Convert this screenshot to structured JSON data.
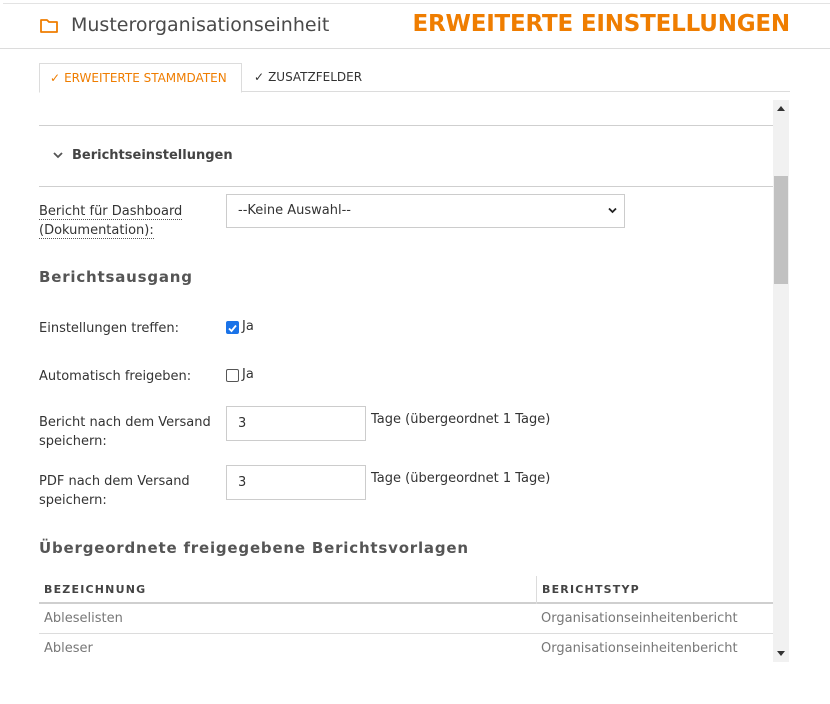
{
  "header": {
    "org_name": "Musterorganisationseinheit",
    "page_title": "ERWEITERTE EINSTELLUNGEN",
    "folder_icon": "folder-icon",
    "accent_color": "#ef7d00"
  },
  "tabs": [
    {
      "label": "ERWEITERTE STAMMDATEN",
      "check": "✓",
      "active": true
    },
    {
      "label": "ZUSATZFELDER",
      "check": "✓",
      "active": false
    }
  ],
  "report_settings": {
    "section_label": "Berichtseinstellungen",
    "dashboard_label_line1": "Bericht für Dashboard",
    "dashboard_label_line2": "(Dokumentation):",
    "dashboard_value": "--Keine Auswahl--"
  },
  "report_output": {
    "heading": "Berichtsausgang",
    "settings_label": "Einstellungen treffen:",
    "settings_checked": true,
    "settings_text": "Ja",
    "auto_label": "Automatisch freigeben:",
    "auto_checked": false,
    "auto_text": "Ja",
    "report_keep_label_line1": "Bericht nach dem Versand",
    "report_keep_label_line2": "speichern:",
    "report_keep_value": "3",
    "report_keep_hint": "Tage (übergeordnet 1 Tage)",
    "pdf_keep_label_line1": "PDF nach dem Versand",
    "pdf_keep_label_line2": "speichern:",
    "pdf_keep_value": "3",
    "pdf_keep_hint": "Tage (übergeordnet 1 Tage)"
  },
  "templates": {
    "heading": "Übergeordnete freigegebene Berichtsvorlagen",
    "columns": [
      "BEZEICHNUNG",
      "BERICHTSTYP"
    ],
    "rows": [
      {
        "name": "Ableselisten",
        "type": "Organisationseinheitenbericht"
      },
      {
        "name": "Ableser",
        "type": "Organisationseinheitenbericht"
      }
    ]
  }
}
